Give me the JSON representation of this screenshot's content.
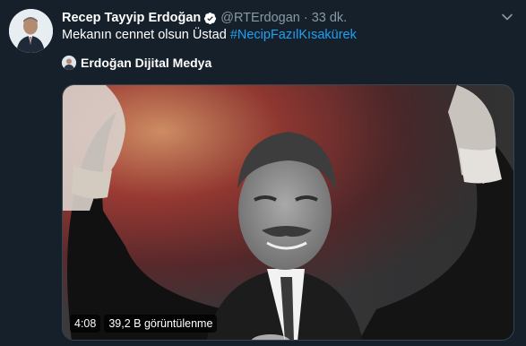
{
  "tweet": {
    "author_name": "Recep Tayyip Erdoğan",
    "handle": "@RTErdogan",
    "separator": "·",
    "time": "33 dk.",
    "text_plain": "Mekanın cennet olsun Üstad ",
    "hashtag": "#NecipFazılKısakürek",
    "source_name": "Erdoğan Dijital Medya",
    "video": {
      "duration": "4:08",
      "views": "39,2 B görüntülenme"
    }
  },
  "icons": {
    "verified": "verified-badge-icon",
    "menu": "chevron-down-icon"
  },
  "colors": {
    "background": "#15202b",
    "secondary_text": "#8899a6",
    "link": "#1da1f2",
    "border": "#38444d"
  }
}
